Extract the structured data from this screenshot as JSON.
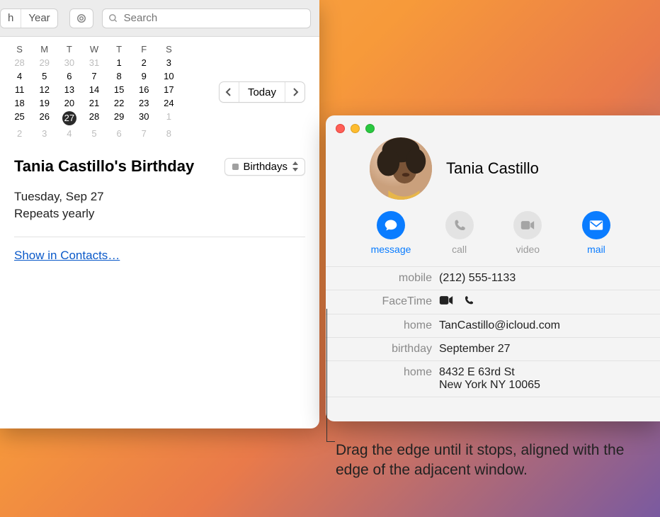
{
  "calendar": {
    "toolbar": {
      "seg_month_frag": "h",
      "seg_year": "Year",
      "search_placeholder": "Search"
    },
    "dow": [
      "S",
      "M",
      "T",
      "W",
      "T",
      "F",
      "S"
    ],
    "dates": [
      {
        "n": "28",
        "dim": true
      },
      {
        "n": "29",
        "dim": true
      },
      {
        "n": "30",
        "dim": true
      },
      {
        "n": "31",
        "dim": true
      },
      {
        "n": "1"
      },
      {
        "n": "2"
      },
      {
        "n": "3"
      },
      {
        "n": "4"
      },
      {
        "n": "5"
      },
      {
        "n": "6"
      },
      {
        "n": "7"
      },
      {
        "n": "8"
      },
      {
        "n": "9"
      },
      {
        "n": "10"
      },
      {
        "n": "11"
      },
      {
        "n": "12"
      },
      {
        "n": "13"
      },
      {
        "n": "14"
      },
      {
        "n": "15"
      },
      {
        "n": "16"
      },
      {
        "n": "17"
      },
      {
        "n": "18"
      },
      {
        "n": "19"
      },
      {
        "n": "20"
      },
      {
        "n": "21"
      },
      {
        "n": "22"
      },
      {
        "n": "23"
      },
      {
        "n": "24"
      },
      {
        "n": "25"
      },
      {
        "n": "26"
      },
      {
        "n": "27",
        "today": true
      },
      {
        "n": "28"
      },
      {
        "n": "29"
      },
      {
        "n": "30"
      },
      {
        "n": "1",
        "dim": true
      },
      {
        "n": "2",
        "dim": true
      },
      {
        "n": "3",
        "dim": true
      },
      {
        "n": "4",
        "dim": true
      },
      {
        "n": "5",
        "dim": true
      },
      {
        "n": "6",
        "dim": true
      },
      {
        "n": "7",
        "dim": true
      },
      {
        "n": "8",
        "dim": true
      }
    ],
    "today_label": "Today",
    "event": {
      "title": "Tania Castillo's Birthday",
      "calendar_name": "Birthdays",
      "date_line": "Tuesday, Sep 27",
      "repeat_line": "Repeats yearly",
      "link": "Show in Contacts…"
    }
  },
  "contact": {
    "name": "Tania Castillo",
    "actions": {
      "message": "message",
      "call": "call",
      "video": "video",
      "mail": "mail"
    },
    "fields": {
      "mobile_label": "mobile",
      "mobile_value": "(212) 555-1133",
      "facetime_label": "FaceTime",
      "home_email_label": "home",
      "home_email_value": "TanCastillo@icloud.com",
      "birthday_label": "birthday",
      "birthday_value": "September 27",
      "home_addr_label": "home",
      "home_addr_line1": "8432 E 63rd St",
      "home_addr_line2": "New York NY 10065"
    }
  },
  "caption": "Drag the edge until it stops, aligned with the edge of the adjacent window."
}
